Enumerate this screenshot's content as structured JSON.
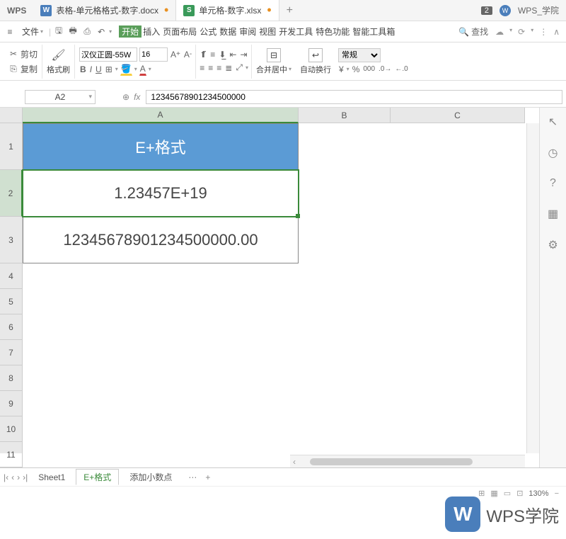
{
  "tabs": {
    "wps": "WPS",
    "doc1_icon": "W",
    "doc1": "表格-单元格格式-数字.docx",
    "doc2_icon": "S",
    "doc2": "单元格-数字.xlsx",
    "badge": "2",
    "profile": "WPS_学院"
  },
  "menu": {
    "file": "文件",
    "tabs": [
      "开始",
      "插入",
      "页面布局",
      "公式",
      "数据",
      "审阅",
      "视图",
      "开发工具",
      "特色功能",
      "智能工具箱"
    ],
    "search": "查找"
  },
  "ribbon": {
    "cut": "剪切",
    "copy": "复制",
    "brush": "格式刷",
    "font": "汉仪正圆-55W",
    "size": "16",
    "merge": "合并居中",
    "wrap": "自动换行",
    "format": "常规"
  },
  "cell_ref": "A2",
  "formula": "12345678901234500000",
  "columns": [
    "A",
    "B",
    "C"
  ],
  "rows": [
    "1",
    "2",
    "3",
    "4",
    "5",
    "6",
    "7",
    "8",
    "9",
    "10",
    "11"
  ],
  "cells": {
    "a1": "E+格式",
    "a2": "1.23457E+19",
    "a3": "12345678901234500000.00"
  },
  "sheets": {
    "s1": "Sheet1",
    "s2": "E+格式",
    "s3": "添加小数点"
  },
  "status": {
    "zoom": "130%"
  },
  "watermark": {
    "logo": "W",
    "text": "WPS学院"
  },
  "chart_data": {
    "type": "table",
    "columns": [
      "A"
    ],
    "rows": [
      {
        "label": "E+格式",
        "values": [
          "header"
        ]
      },
      {
        "label": "1.23457E+19",
        "values": [
          1.23457e+19
        ]
      },
      {
        "label": "12345678901234500000.00",
        "values": [
          12345678901234500000
        ]
      }
    ]
  }
}
